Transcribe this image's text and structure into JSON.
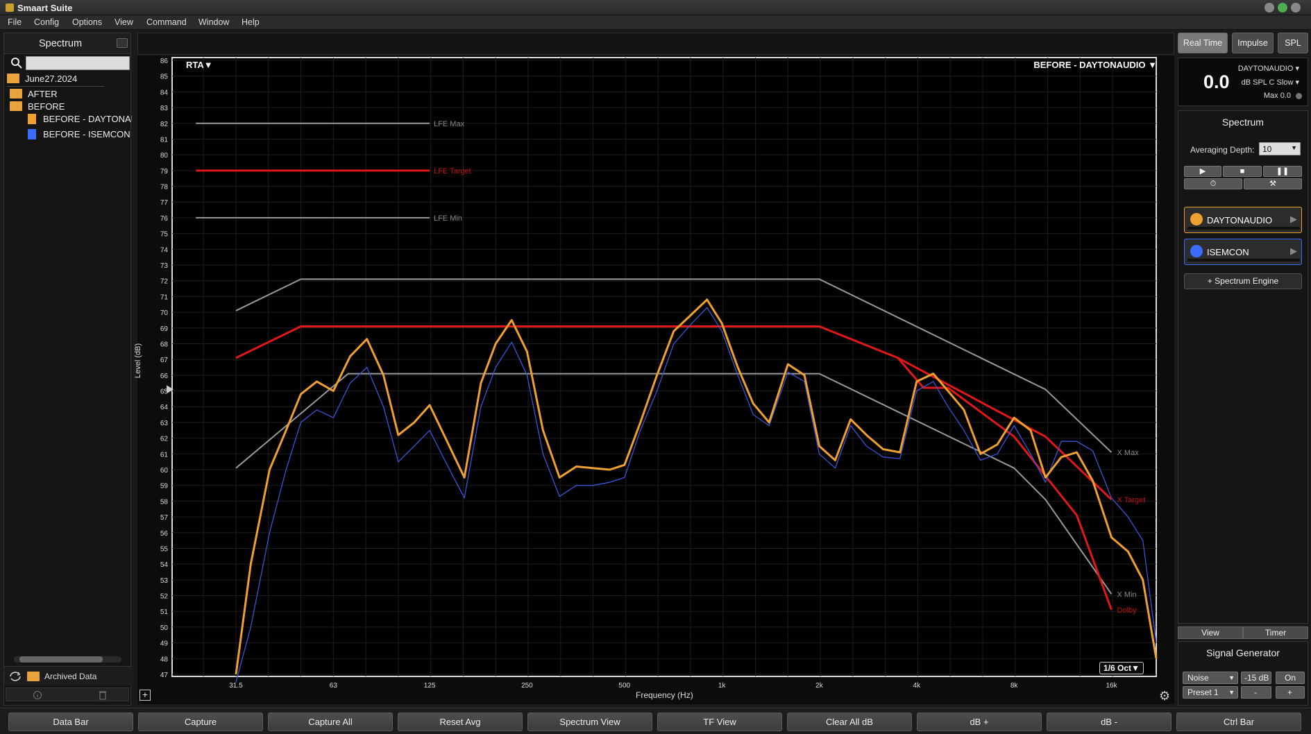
{
  "window": {
    "title": "Smaart Suite"
  },
  "menu": [
    "File",
    "Config",
    "Options",
    "View",
    "Command",
    "Window",
    "Help"
  ],
  "left_panel": {
    "title": "Spectrum",
    "search_value": "",
    "session": "June27.2024",
    "folders": [
      {
        "label": "AFTER"
      },
      {
        "label": "BEFORE",
        "children": [
          {
            "label": "BEFORE - DAYTONAUDIO",
            "color": "#f0a030"
          },
          {
            "label": "BEFORE - ISEMCON",
            "color": "#3c6cff"
          }
        ]
      }
    ],
    "archived": "Archived Data"
  },
  "plot": {
    "mode_label": "RTA",
    "trace_label": "BEFORE - DAYTONAUDIO",
    "resolution": "1/6 Oct",
    "ylabel": "Level (dB)",
    "xlabel": "Frequency (Hz)",
    "yticks": [
      86,
      85,
      84,
      83,
      82,
      81,
      80,
      79,
      78,
      77,
      76,
      75,
      74,
      73,
      72,
      71,
      70,
      69,
      68,
      67,
      66,
      65,
      64,
      63,
      62,
      61,
      60,
      59,
      58,
      57,
      56,
      55,
      54,
      53,
      52,
      51,
      50,
      49,
      48,
      47
    ],
    "xticks": [
      "31.5",
      "63",
      "125",
      "250",
      "500",
      "1k",
      "2k",
      "4k",
      "8k",
      "16k"
    ]
  },
  "chart_data": {
    "type": "line",
    "xscale": "log",
    "ylim": [
      47,
      86
    ],
    "xlim": [
      20,
      22000
    ],
    "xlabel": "Frequency (Hz)",
    "ylabel": "Level (dB)",
    "reference_lines": [
      {
        "label": "LFE Max",
        "y": 82,
        "x": [
          22,
          125
        ],
        "color": "#9a9a9a"
      },
      {
        "label": "LFE Target",
        "y": 79,
        "x": [
          22,
          125
        ],
        "color": "#e01818"
      },
      {
        "label": "LFE Min",
        "y": 76,
        "x": [
          22,
          125
        ],
        "color": "#9a9a9a"
      }
    ],
    "series": [
      {
        "name": "X Max",
        "color": "#9a9a9a",
        "x": [
          31.5,
          50,
          2000,
          10000,
          16000
        ],
        "y": [
          70.1,
          72.1,
          72.1,
          65.1,
          61.1
        ]
      },
      {
        "name": "X Target",
        "color": "#e01818",
        "x": [
          31.5,
          50,
          2000,
          3500,
          10000,
          16000
        ],
        "y": [
          67.1,
          69.1,
          69.1,
          67.1,
          62.1,
          58.1
        ]
      },
      {
        "name": "X Min",
        "color": "#9a9a9a",
        "x": [
          31.5,
          70,
          2000,
          8000,
          10000,
          16000
        ],
        "y": [
          60.1,
          66.1,
          66.1,
          60.1,
          58.1,
          52.1
        ]
      },
      {
        "name": "Dolby",
        "color": "#e01818",
        "x": [
          3500,
          4200,
          5000,
          8000,
          12500,
          16000
        ],
        "y": [
          67.1,
          65.2,
          65.2,
          62.1,
          57.1,
          51.1
        ]
      },
      {
        "name": "ISEMCON",
        "color": "#3c55d8",
        "x": [
          31.5,
          35,
          40,
          45,
          50,
          56,
          63,
          71,
          80,
          90,
          100,
          112,
          125,
          140,
          160,
          180,
          200,
          224,
          250,
          280,
          315,
          355,
          400,
          450,
          500,
          560,
          630,
          710,
          800,
          900,
          1000,
          1120,
          1250,
          1400,
          1600,
          1800,
          2000,
          2240,
          2500,
          2800,
          3150,
          3550,
          4000,
          4500,
          5000,
          5600,
          6300,
          7100,
          8000,
          9000,
          10000,
          11200,
          12500,
          14000,
          16000,
          18000,
          20000,
          22000
        ],
        "y": [
          42,
          50,
          56,
          60,
          63,
          63.8,
          63.3,
          65.5,
          66.5,
          64,
          60.5,
          61.5,
          62.5,
          60.5,
          58.2,
          64,
          66.5,
          68.1,
          66,
          61,
          58.3,
          59,
          59,
          59.2,
          59.5,
          62.5,
          65,
          68,
          69.2,
          70.3,
          68.8,
          66,
          63.5,
          62.8,
          66.2,
          65.6,
          61,
          60.1,
          62.8,
          61.5,
          60.8,
          60.7,
          65,
          65.6,
          64,
          62.5,
          60.6,
          61,
          62.8,
          61,
          59.2,
          61.8,
          61.8,
          61.2,
          58.2,
          57,
          55.5,
          49
        ]
      },
      {
        "name": "DAYTONAUDIO",
        "color": "#f0a030",
        "x": [
          31.5,
          35,
          40,
          45,
          50,
          56,
          63,
          71,
          80,
          90,
          100,
          112,
          125,
          140,
          160,
          180,
          200,
          224,
          250,
          280,
          315,
          355,
          400,
          450,
          500,
          560,
          630,
          710,
          800,
          900,
          1000,
          1120,
          1250,
          1400,
          1600,
          1800,
          2000,
          2240,
          2500,
          2800,
          3150,
          3550,
          4000,
          4500,
          5000,
          5600,
          6300,
          7100,
          8000,
          9000,
          10000,
          11200,
          12500,
          14000,
          16000,
          18000,
          20000,
          22000
        ],
        "y": [
          47,
          54,
          60,
          62.5,
          64.8,
          65.6,
          65,
          67.2,
          68.3,
          66,
          62.2,
          63,
          64.1,
          62,
          59.5,
          65.5,
          68,
          69.5,
          67.5,
          62.5,
          59.5,
          60.2,
          60.1,
          60,
          60.3,
          63,
          66,
          68.8,
          69.8,
          70.8,
          69.3,
          66.5,
          64.2,
          63,
          66.7,
          66,
          61.5,
          60.6,
          63.2,
          62.2,
          61.3,
          61.1,
          65.6,
          66.1,
          65,
          63.8,
          61,
          61.6,
          63.3,
          62.5,
          59.5,
          60.8,
          61.1,
          59.3,
          55.7,
          54.8,
          53,
          48
        ]
      }
    ]
  },
  "right_panel": {
    "modes": [
      "Real Time",
      "Impulse",
      "SPL"
    ],
    "meter": {
      "value": "0.0",
      "source": "DAYTONAUDIO",
      "weighting": "dB SPL C Slow",
      "max": "Max 0.0"
    },
    "spectrum_title": "Spectrum",
    "averaging_label": "Averaging Depth:",
    "averaging_value": "10",
    "engines": [
      {
        "name": "DAYTONAUDIO",
        "color": "#f0a030"
      },
      {
        "name": "ISEMCON",
        "color": "#3c6cff"
      }
    ],
    "add_engine": "+ Spectrum Engine",
    "tabs": [
      "View",
      "Timer"
    ],
    "signal_generator": {
      "title": "Signal Generator",
      "type": "Noise",
      "level": "-15 dB",
      "state": "On",
      "preset": "Preset 1",
      "minus": "-",
      "plus": "+"
    }
  },
  "bottom_buttons": [
    "Data Bar",
    "Capture",
    "Capture All",
    "Reset Avg",
    "Spectrum View",
    "TF View",
    "Clear All dB",
    "dB +",
    "dB -",
    "Ctrl Bar"
  ]
}
